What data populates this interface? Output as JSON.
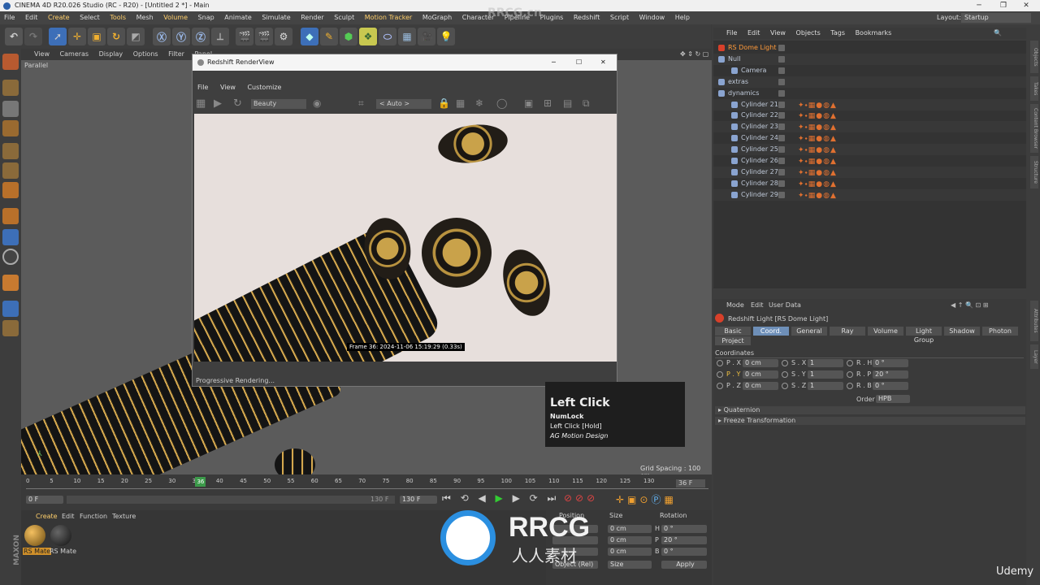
{
  "window": {
    "title": "CINEMA 4D R20.026 Studio (RC - R20) - [Untitled 2 *] - Main",
    "layout_label": "Layout:",
    "layout_value": "Startup"
  },
  "menu": [
    "File",
    "Edit",
    "Create",
    "Select",
    "Tools",
    "Mesh",
    "Volume",
    "Snap",
    "Animate",
    "Simulate",
    "Render",
    "Sculpt",
    "Motion Tracker",
    "MoGraph",
    "Character",
    "Pipeline",
    "Plugins",
    "Redshift",
    "Script",
    "Window",
    "Help"
  ],
  "viewport": {
    "menu": [
      "View",
      "Cameras",
      "Display",
      "Options",
      "Filter",
      "Panel"
    ],
    "projection": "Parallel",
    "grid_spacing": "Grid Spacing : 100 cm"
  },
  "renderview": {
    "title": "Redshift RenderView",
    "menu": [
      "File",
      "View",
      "Customize"
    ],
    "aov": "Beauty",
    "zoom": "< Auto >",
    "frame_info": "Frame  36:  2024-11-06  15:19:29  (0.33s)",
    "status": "Progressive Rendering..."
  },
  "tooltip": {
    "title": "Left Click",
    "line1": "NumLock",
    "line2": "Left Click [Hold]",
    "line3": "AG Motion Design"
  },
  "objects": {
    "menu": [
      "File",
      "Edit",
      "View",
      "Objects",
      "Tags",
      "Bookmarks"
    ],
    "rows": [
      {
        "name": "RS Dome Light",
        "indent": 0
      },
      {
        "name": "Null",
        "indent": 0
      },
      {
        "name": "Camera",
        "indent": 1
      },
      {
        "name": "extras",
        "indent": 0
      },
      {
        "name": "dynamics",
        "indent": 0
      },
      {
        "name": "Cylinder 21",
        "indent": 1
      },
      {
        "name": "Cylinder 22",
        "indent": 1
      },
      {
        "name": "Cylinder 23",
        "indent": 1
      },
      {
        "name": "Cylinder 24",
        "indent": 1
      },
      {
        "name": "Cylinder 25",
        "indent": 1
      },
      {
        "name": "Cylinder 26",
        "indent": 1
      },
      {
        "name": "Cylinder 27",
        "indent": 1
      },
      {
        "name": "Cylinder 28",
        "indent": 1
      },
      {
        "name": "Cylinder 29",
        "indent": 1
      }
    ]
  },
  "attributes": {
    "menu": [
      "Mode",
      "Edit",
      "User Data"
    ],
    "object_title": "Redshift Light [RS Dome Light]",
    "tabs": [
      "Basic",
      "Coord.",
      "General",
      "Ray",
      "Volume",
      "Light Group",
      "Shadow",
      "Photon",
      "Project"
    ],
    "active_tab": "Coord.",
    "section": "Coordinates",
    "rows": [
      {
        "p_label": "P . X",
        "p_val": "0 cm",
        "s_label": "S . X",
        "s_val": "1",
        "r_label": "R . H",
        "r_val": "0 °"
      },
      {
        "p_label": "P . Y",
        "p_val": "0 cm",
        "s_label": "S . Y",
        "s_val": "1",
        "r_label": "R . P",
        "r_val": "20 °"
      },
      {
        "p_label": "P . Z",
        "p_val": "0 cm",
        "s_label": "S . Z",
        "s_val": "1",
        "r_label": "R . B",
        "r_val": "0 °"
      }
    ],
    "order_label": "Order",
    "order_value": "HPB",
    "groups": [
      "Quaternion",
      "Freeze Transformation"
    ]
  },
  "timeline": {
    "ticks": [
      "0",
      "5",
      "10",
      "15",
      "20",
      "25",
      "30",
      "35",
      "40",
      "45",
      "50",
      "55",
      "60",
      "65",
      "70",
      "75",
      "80",
      "85",
      "90",
      "95",
      "100",
      "105",
      "110",
      "115",
      "120",
      "125",
      "130"
    ],
    "current_frame": "36",
    "current_frame_label": "36 F",
    "start_field": "0 F",
    "end_field": "130 F",
    "end_field2": "130 F"
  },
  "materials": {
    "menu": [
      "Create",
      "Edit",
      "Function",
      "Texture"
    ],
    "items": [
      "RS Mate",
      "RS Mate"
    ]
  },
  "coords": {
    "headers": [
      "Position",
      "Size",
      "Rotation"
    ],
    "rows": [
      {
        "size": "0 cm",
        "r_label": "H",
        "rot": "0 °"
      },
      {
        "size": "0 cm",
        "r_label": "P",
        "rot": "20 °"
      },
      {
        "size": "0 cm",
        "r_label": "B",
        "rot": "0 °"
      }
    ],
    "mode": "Object (Rel)",
    "size_mode": "Size",
    "apply": "Apply"
  },
  "watermark": {
    "brand": "RRCG",
    "sub": "人人素材",
    "top": "RRCG.cn",
    "udemy": "Udemy"
  },
  "colors": {
    "accent": "#ffb640",
    "active_tab": "#6e8fb8",
    "object_text": "#bfc9d8",
    "dome_light": "#ff9a3a"
  }
}
